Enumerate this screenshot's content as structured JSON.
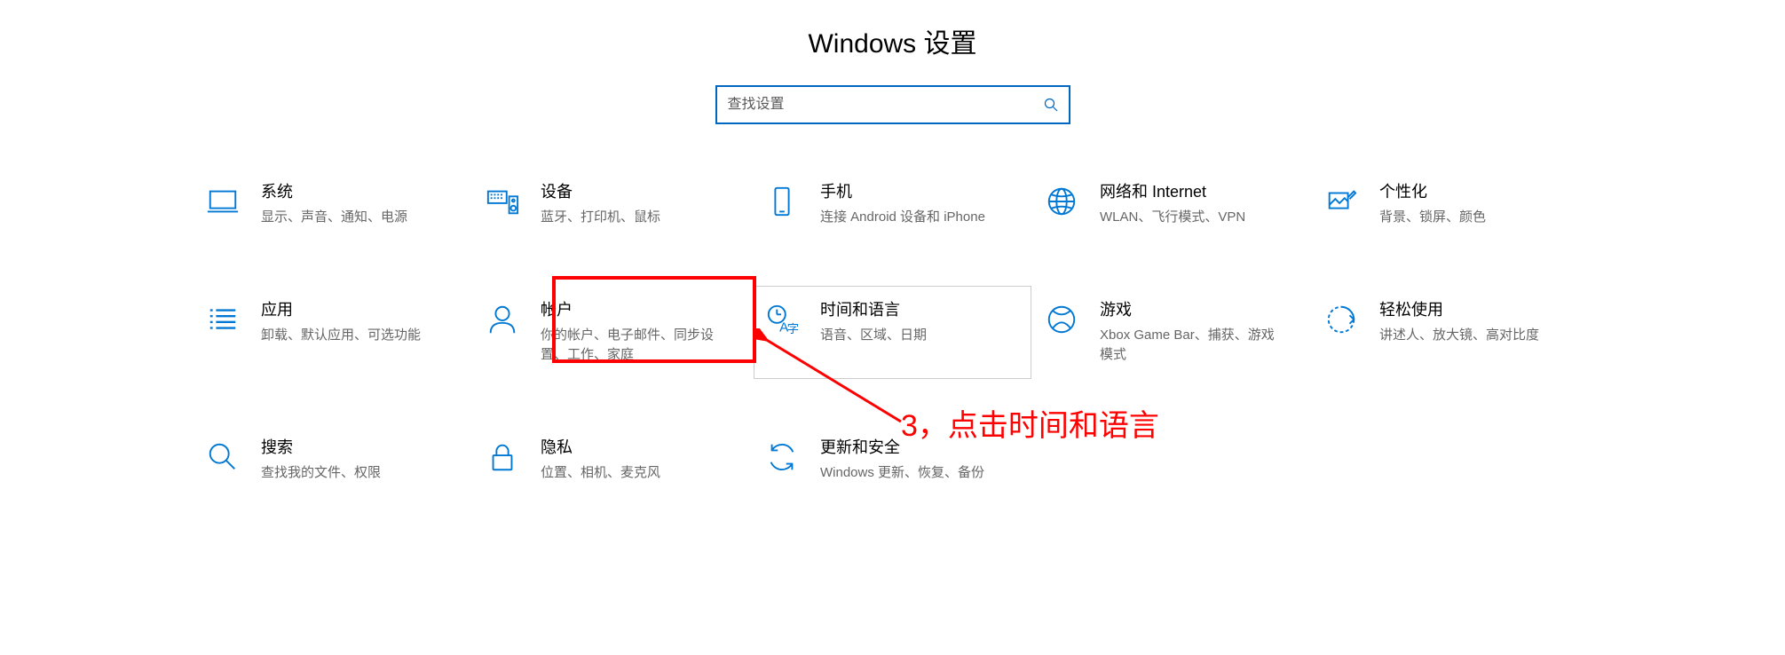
{
  "page_title": "Windows 设置",
  "search": {
    "placeholder": "查找设置"
  },
  "tiles": [
    {
      "id": "system",
      "label": "系统",
      "desc": "显示、声音、通知、电源"
    },
    {
      "id": "devices",
      "label": "设备",
      "desc": "蓝牙、打印机、鼠标"
    },
    {
      "id": "phone",
      "label": "手机",
      "desc": "连接 Android 设备和 iPhone"
    },
    {
      "id": "network",
      "label": "网络和 Internet",
      "desc": "WLAN、飞行模式、VPN"
    },
    {
      "id": "personalization",
      "label": "个性化",
      "desc": "背景、锁屏、颜色"
    },
    {
      "id": "apps",
      "label": "应用",
      "desc": "卸载、默认应用、可选功能"
    },
    {
      "id": "accounts",
      "label": "帐户",
      "desc": "你的帐户、电子邮件、同步设置、工作、家庭"
    },
    {
      "id": "time-language",
      "label": "时间和语言",
      "desc": "语音、区域、日期"
    },
    {
      "id": "gaming",
      "label": "游戏",
      "desc": "Xbox Game Bar、捕获、游戏模式"
    },
    {
      "id": "ease-of-access",
      "label": "轻松使用",
      "desc": "讲述人、放大镜、高对比度"
    },
    {
      "id": "search",
      "label": "搜索",
      "desc": "查找我的文件、权限"
    },
    {
      "id": "privacy",
      "label": "隐私",
      "desc": "位置、相机、麦克风"
    },
    {
      "id": "update",
      "label": "更新和安全",
      "desc": "Windows 更新、恢复、备份"
    }
  ],
  "annotation_text": "3，点击时间和语言",
  "icons": {
    "system": "laptop-icon",
    "devices": "keyboard-speaker-icon",
    "phone": "phone-icon",
    "network": "globe-icon",
    "personalization": "paint-icon",
    "apps": "list-icon",
    "accounts": "person-icon",
    "time-language": "clock-language-icon",
    "gaming": "xbox-icon",
    "ease-of-access": "accessibility-icon",
    "search": "magnifier-icon",
    "privacy": "lock-icon",
    "update": "refresh-icon"
  }
}
